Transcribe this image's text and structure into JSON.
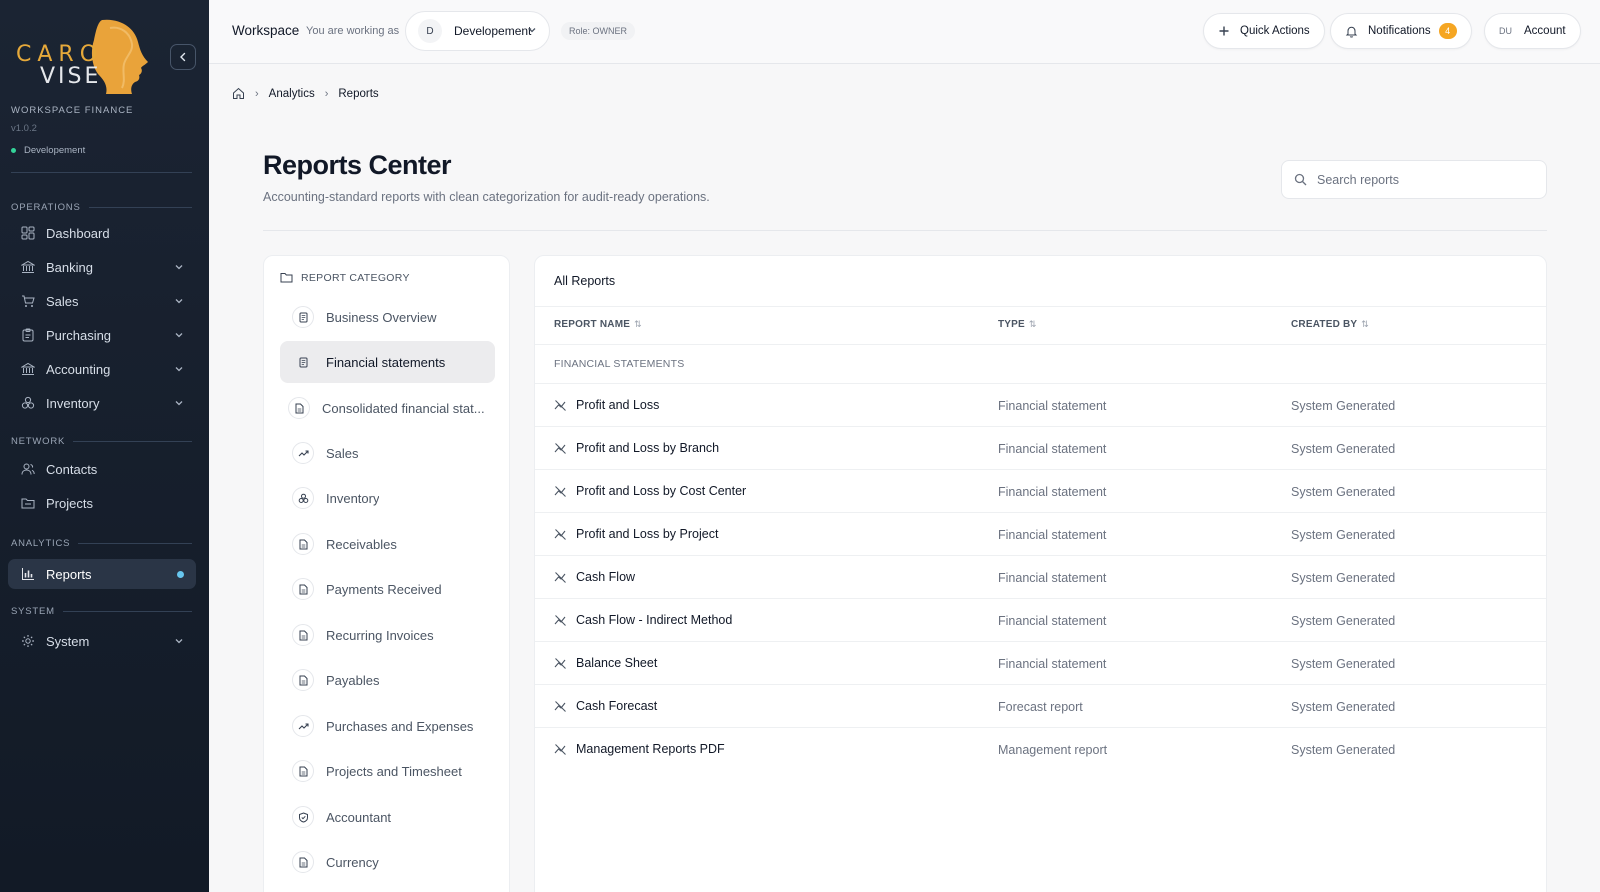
{
  "brand": {
    "logo_top": "CARO",
    "logo_bottom": "VISE",
    "workspace_title": "WORKSPACE FINANCE",
    "version": "v1.0.2",
    "environment": "Developement",
    "accent": "#e6a93a"
  },
  "sidebar": {
    "sections": {
      "operations": "OPERATIONS",
      "network": "NETWORK",
      "analytics": "ANALYTICS",
      "system": "SYSTEM"
    },
    "items": [
      {
        "label": "Dashboard",
        "icon": "dashboard-icon"
      },
      {
        "label": "Banking",
        "icon": "bank-icon"
      },
      {
        "label": "Sales",
        "icon": "cart-icon"
      },
      {
        "label": "Purchasing",
        "icon": "clipboard-icon"
      },
      {
        "label": "Accounting",
        "icon": "bank-icon"
      },
      {
        "label": "Inventory",
        "icon": "boxes-icon"
      },
      {
        "label": "Contacts",
        "icon": "users-icon"
      },
      {
        "label": "Projects",
        "icon": "folder-icon"
      },
      {
        "label": "Reports",
        "icon": "bar-chart-icon",
        "active": true
      },
      {
        "label": "System",
        "icon": "gear-icon"
      }
    ]
  },
  "topbar": {
    "workspace_label": "Workspace",
    "working_as": "You are working as",
    "workspace_initial": "D",
    "workspace_name": "Developement",
    "role": "Role: OWNER",
    "quick_actions": "Quick Actions",
    "notifications": "Notifications",
    "notifications_count": "4",
    "account_initials": "DU",
    "account": "Account"
  },
  "breadcrumb": {
    "home_icon": "home-icon",
    "items": [
      "Analytics",
      "Reports"
    ]
  },
  "page": {
    "title": "Reports Center",
    "subtitle": "Accounting-standard reports with clean categorization for audit-ready operations.",
    "search_placeholder": "Search reports"
  },
  "categories": {
    "header": "REPORT CATEGORY",
    "items": [
      {
        "label": "Business Overview",
        "icon": "document-icon"
      },
      {
        "label": "Financial statements",
        "icon": "document-icon",
        "active": true
      },
      {
        "label": "Consolidated financial stat...",
        "icon": "file-icon"
      },
      {
        "label": "Sales",
        "icon": "trend-up-icon"
      },
      {
        "label": "Inventory",
        "icon": "boxes-icon"
      },
      {
        "label": "Receivables",
        "icon": "file-icon"
      },
      {
        "label": "Payments Received",
        "icon": "file-icon"
      },
      {
        "label": "Recurring Invoices",
        "icon": "file-icon"
      },
      {
        "label": "Payables",
        "icon": "file-icon"
      },
      {
        "label": "Purchases and Expenses",
        "icon": "trend-up-icon"
      },
      {
        "label": "Projects and Timesheet",
        "icon": "file-icon"
      },
      {
        "label": "Accountant",
        "icon": "shield-check-icon"
      },
      {
        "label": "Currency",
        "icon": "file-icon"
      }
    ]
  },
  "reports": {
    "title": "All Reports",
    "columns": {
      "name": "REPORT NAME",
      "type": "TYPE",
      "created_by": "CREATED BY"
    },
    "group": "FINANCIAL STATEMENTS",
    "rows": [
      {
        "name": "Profit and Loss",
        "type": "Financial statement",
        "created_by": "System Generated"
      },
      {
        "name": "Profit and Loss by Branch",
        "type": "Financial statement",
        "created_by": "System Generated"
      },
      {
        "name": "Profit and Loss by Cost Center",
        "type": "Financial statement",
        "created_by": "System Generated"
      },
      {
        "name": "Profit and Loss by Project",
        "type": "Financial statement",
        "created_by": "System Generated"
      },
      {
        "name": "Cash Flow",
        "type": "Financial statement",
        "created_by": "System Generated"
      },
      {
        "name": "Cash Flow - Indirect Method",
        "type": "Financial statement",
        "created_by": "System Generated"
      },
      {
        "name": "Balance Sheet",
        "type": "Financial statement",
        "created_by": "System Generated"
      },
      {
        "name": "Cash Forecast",
        "type": "Forecast report",
        "created_by": "System Generated"
      },
      {
        "name": "Management Reports PDF",
        "type": "Management report",
        "created_by": "System Generated"
      }
    ]
  }
}
